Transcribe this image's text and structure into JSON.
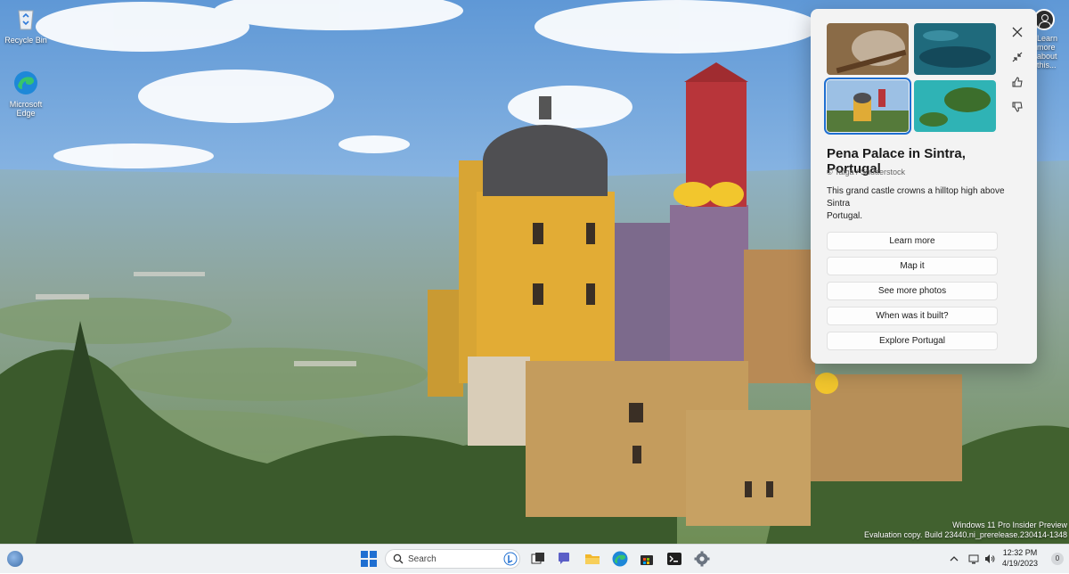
{
  "desktop": {
    "icons": [
      {
        "label": "Recycle Bin"
      },
      {
        "label": "Microsoft\nEdge"
      }
    ],
    "learn_more_label": "Learn more\nabout this..."
  },
  "spotlight": {
    "title": "Pena Palace in Sintra, Portugal",
    "credit": "© Taiga / Shutterstock",
    "description": "This grand castle crowns a hilltop high above Sintra\n Portugal.",
    "actions": [
      "Learn more",
      "Map it",
      "See more photos",
      "When was it built?",
      "Explore Portugal"
    ],
    "selected_thumbnail": 3,
    "side_icons": [
      "close-icon",
      "minimize-icon",
      "like-icon",
      "dislike-icon"
    ]
  },
  "watermark": {
    "line1": "Windows 11 Pro Insider Preview",
    "line2": "Evaluation copy. Build 23440.ni_prerelease.230414-1348"
  },
  "taskbar": {
    "search_placeholder": "Search",
    "pinned_icons": [
      "start-icon",
      "task-view-icon",
      "teams-icon",
      "file-explorer-icon",
      "edge-icon",
      "store-icon",
      "terminal-icon",
      "settings-icon"
    ],
    "clock_time": "12:32 PM",
    "clock_date": "4/19/2023",
    "notification_count": "0",
    "colors": {
      "accent": "#1f6fd1",
      "taskbar": "#eef1f3"
    }
  }
}
